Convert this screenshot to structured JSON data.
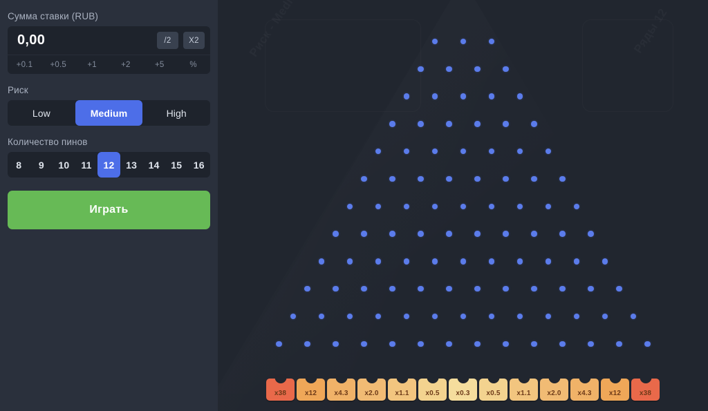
{
  "sidebar": {
    "bet": {
      "label": "Сумма ставки (RUB)",
      "value": "0,00",
      "placeholder": "0,00",
      "half_label": "/2",
      "double_label": "X2",
      "steps": [
        "+0.1",
        "+0.5",
        "+1",
        "+2",
        "+5",
        "%"
      ]
    },
    "risk": {
      "label": "Риск",
      "options": [
        "Low",
        "Medium",
        "High"
      ],
      "selected": "Medium"
    },
    "pins": {
      "label": "Количество пинов",
      "options": [
        "8",
        "9",
        "10",
        "11",
        "12",
        "13",
        "14",
        "15",
        "16"
      ],
      "selected": "12"
    },
    "play_button": {
      "label": "Играть"
    }
  },
  "board": {
    "watermark_left": "Риск - Medium",
    "watermark_right": "Ряды 12",
    "peg_color": "#5b7ceb",
    "rows": [
      3,
      4,
      5,
      6,
      7,
      8,
      9,
      10,
      11,
      12,
      13,
      14
    ],
    "row_count": 12,
    "buckets": [
      {
        "label": "x38",
        "color": "#e9694a"
      },
      {
        "label": "x12",
        "color": "#efa758"
      },
      {
        "label": "x4.3",
        "color": "#f0b268"
      },
      {
        "label": "x2.0",
        "color": "#f1bb74"
      },
      {
        "label": "x1.1",
        "color": "#f2c57f"
      },
      {
        "label": "x0.5",
        "color": "#f3d38f"
      },
      {
        "label": "x0.3",
        "color": "#f5dd9d"
      },
      {
        "label": "x0.5",
        "color": "#f3d38f"
      },
      {
        "label": "x1.1",
        "color": "#f2c57f"
      },
      {
        "label": "x2.0",
        "color": "#f1bb74"
      },
      {
        "label": "x4.3",
        "color": "#f0b268"
      },
      {
        "label": "x12",
        "color": "#efa758"
      },
      {
        "label": "x38",
        "color": "#e9694a"
      }
    ]
  },
  "theme": {
    "page_bg": "#21262f",
    "sidebar_bg": "#2a303c",
    "input_bg": "#1e232c",
    "accent_blue": "#4d6ee8",
    "accent_green": "#67ba56"
  }
}
